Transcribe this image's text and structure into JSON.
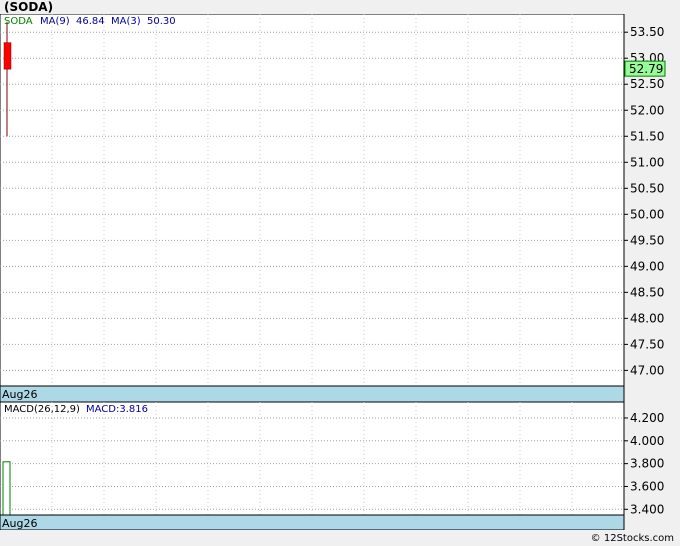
{
  "title": "(SODA)",
  "footer": "© 12Stocks.com",
  "price_legend": {
    "symbol": "SODA",
    "ma9_label": "MA(9)",
    "ma9_value": "46.84",
    "ma3_label": "MA(3)",
    "ma3_value": "50.30"
  },
  "macd_legend": {
    "label": "MACD(26,12,9)",
    "value_label": "MACD:3.816"
  },
  "date_label": "Aug26",
  "last_price_label": "52.79",
  "colors": {
    "candle_down": "#ff0000",
    "wick": "#800000",
    "macd_bar": "#008000",
    "date_band": "#add8e6",
    "last_price_bg": "#98fb98",
    "grid": "#a0a0a0"
  },
  "chart_data": [
    {
      "type": "candlestick",
      "title": "(SODA)",
      "ylim": [
        46.7,
        53.85
      ],
      "yticks": [
        "53.50",
        "53.00",
        "52.50",
        "52.00",
        "51.50",
        "51.00",
        "50.50",
        "50.00",
        "49.50",
        "49.00",
        "48.50",
        "48.00",
        "47.50",
        "47.00"
      ],
      "x": [
        "Aug26"
      ],
      "candles": [
        {
          "date": "Aug26",
          "open": 53.3,
          "high": 53.7,
          "low": 51.5,
          "close": 52.79
        }
      ],
      "last_price": 52.79,
      "legend": [
        "SODA",
        "MA(9) 46.84",
        "MA(3) 50.30"
      ]
    },
    {
      "type": "bar",
      "title": "MACD(26,12,9)",
      "ylim": [
        3.35,
        4.34
      ],
      "yticks": [
        "4.200",
        "4.000",
        "3.800",
        "3.600",
        "3.400"
      ],
      "x": [
        "Aug26"
      ],
      "values": [
        3.816
      ]
    }
  ]
}
